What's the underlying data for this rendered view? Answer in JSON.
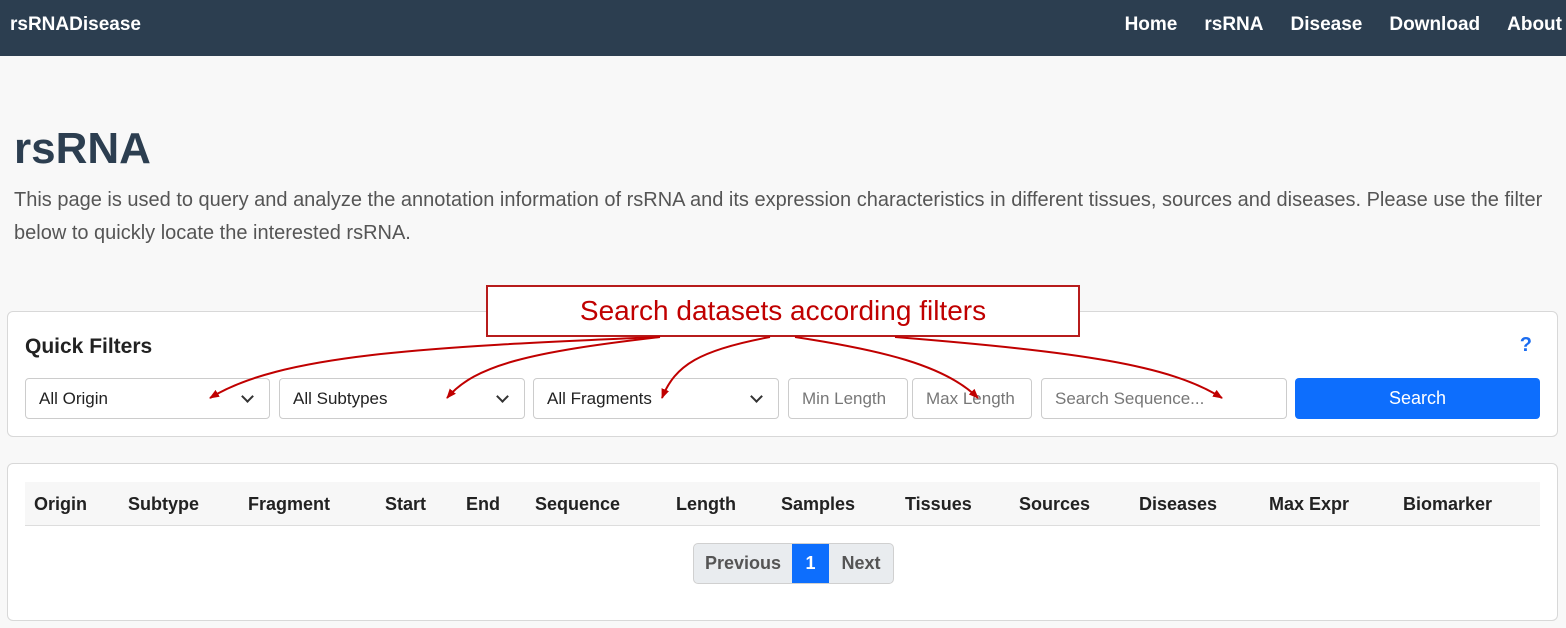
{
  "navbar": {
    "brand": "rsRNADisease",
    "links": [
      "Home",
      "rsRNA",
      "Disease",
      "Download",
      "About"
    ]
  },
  "page": {
    "title": "rsRNA",
    "description": "This page is used to query and analyze the annotation information of rsRNA and its expression characteristics in different tissues, sources and diseases. Please use the filter below to quickly locate the interested rsRNA."
  },
  "filters": {
    "title": "Quick Filters",
    "help": "?",
    "origin_value": "All Origin",
    "subtype_value": "All Subtypes",
    "fragment_value": "All Fragments",
    "min_length_placeholder": "Min Length",
    "max_length_placeholder": "Max Length",
    "sequence_placeholder": "Search Sequence...",
    "search_label": "Search"
  },
  "table": {
    "columns": [
      "Origin",
      "Subtype",
      "Fragment",
      "Start",
      "End",
      "Sequence",
      "Length",
      "Samples",
      "Tissues",
      "Sources",
      "Diseases",
      "Max Expr",
      "Biomarker"
    ],
    "rows": []
  },
  "pagination": {
    "previous": "Previous",
    "current": "1",
    "next": "Next"
  },
  "annotation": {
    "text": "Search datasets according filters",
    "color": "#c00000"
  },
  "colors": {
    "navbar": "#2c3e50",
    "primary": "#0d6efd",
    "help": "#1a6cf0"
  }
}
